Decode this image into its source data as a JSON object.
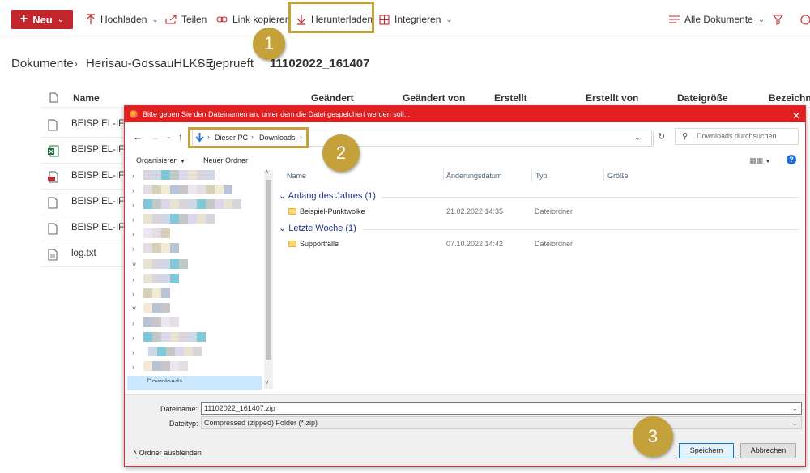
{
  "toolbar": {
    "new_label": "Neu",
    "upload_label": "Hochladen",
    "share_label": "Teilen",
    "copy_link_label": "Link kopieren",
    "download_label": "Herunterladen",
    "integrate_label": "Integrieren",
    "view_label": "Alle Dokumente"
  },
  "breadcrumb": {
    "root": "Dokumente",
    "level1": "Herisau-GossauHLKSE",
    "level2": "geprueft",
    "current": "11102022_161407"
  },
  "list": {
    "columns": [
      "Name",
      "Geändert",
      "Geändert von",
      "Erstellt",
      "Erstellt von",
      "Dateigröße",
      "Bezeichnu"
    ],
    "rows": [
      "BEISPIEL-IFC_",
      "BEISPIEL-IFC_",
      "BEISPIEL-IFC_",
      "BEISPIEL-IFC_",
      "BEISPIEL-IFC_",
      "log.txt"
    ]
  },
  "dialog": {
    "title": "Bitte geben Sie den Dateinamen an, unter dem die Datei gespeichert werden soll...",
    "path": [
      "Dieser PC",
      "Downloads"
    ],
    "search_placeholder": "Downloads durchsuchen",
    "organize_label": "Organisieren",
    "new_folder_label": "Neuer Ordner",
    "nav_bottom_label": "Downloads",
    "columns": [
      "Name",
      "Änderungsdatum",
      "Typ",
      "Größe"
    ],
    "groups": [
      {
        "label": "Anfang des Jahres (1)",
        "name": "Beispiel-Punktwolke",
        "date": "21.02.2022 14:35",
        "type": "Dateiordner"
      },
      {
        "label": "Letzte Woche (1)",
        "name": "Supportfälle",
        "date": "07.10.2022 14:42",
        "type": "Dateiordner"
      }
    ],
    "filename_label": "Dateiname:",
    "filename_value": "11102022_161407.zip",
    "filetype_label": "Dateityp:",
    "filetype_value": "Compressed (zipped) Folder (*.zip)",
    "hide_folders_label": "Ordner ausblenden",
    "save_label": "Speichern",
    "cancel_label": "Abbrechen"
  },
  "callouts": [
    "1",
    "2",
    "3"
  ],
  "colors": {
    "accent": "#c4262e",
    "callout": "#c5a13b",
    "dialog_title": "#e02020",
    "link": "#1e3287"
  }
}
